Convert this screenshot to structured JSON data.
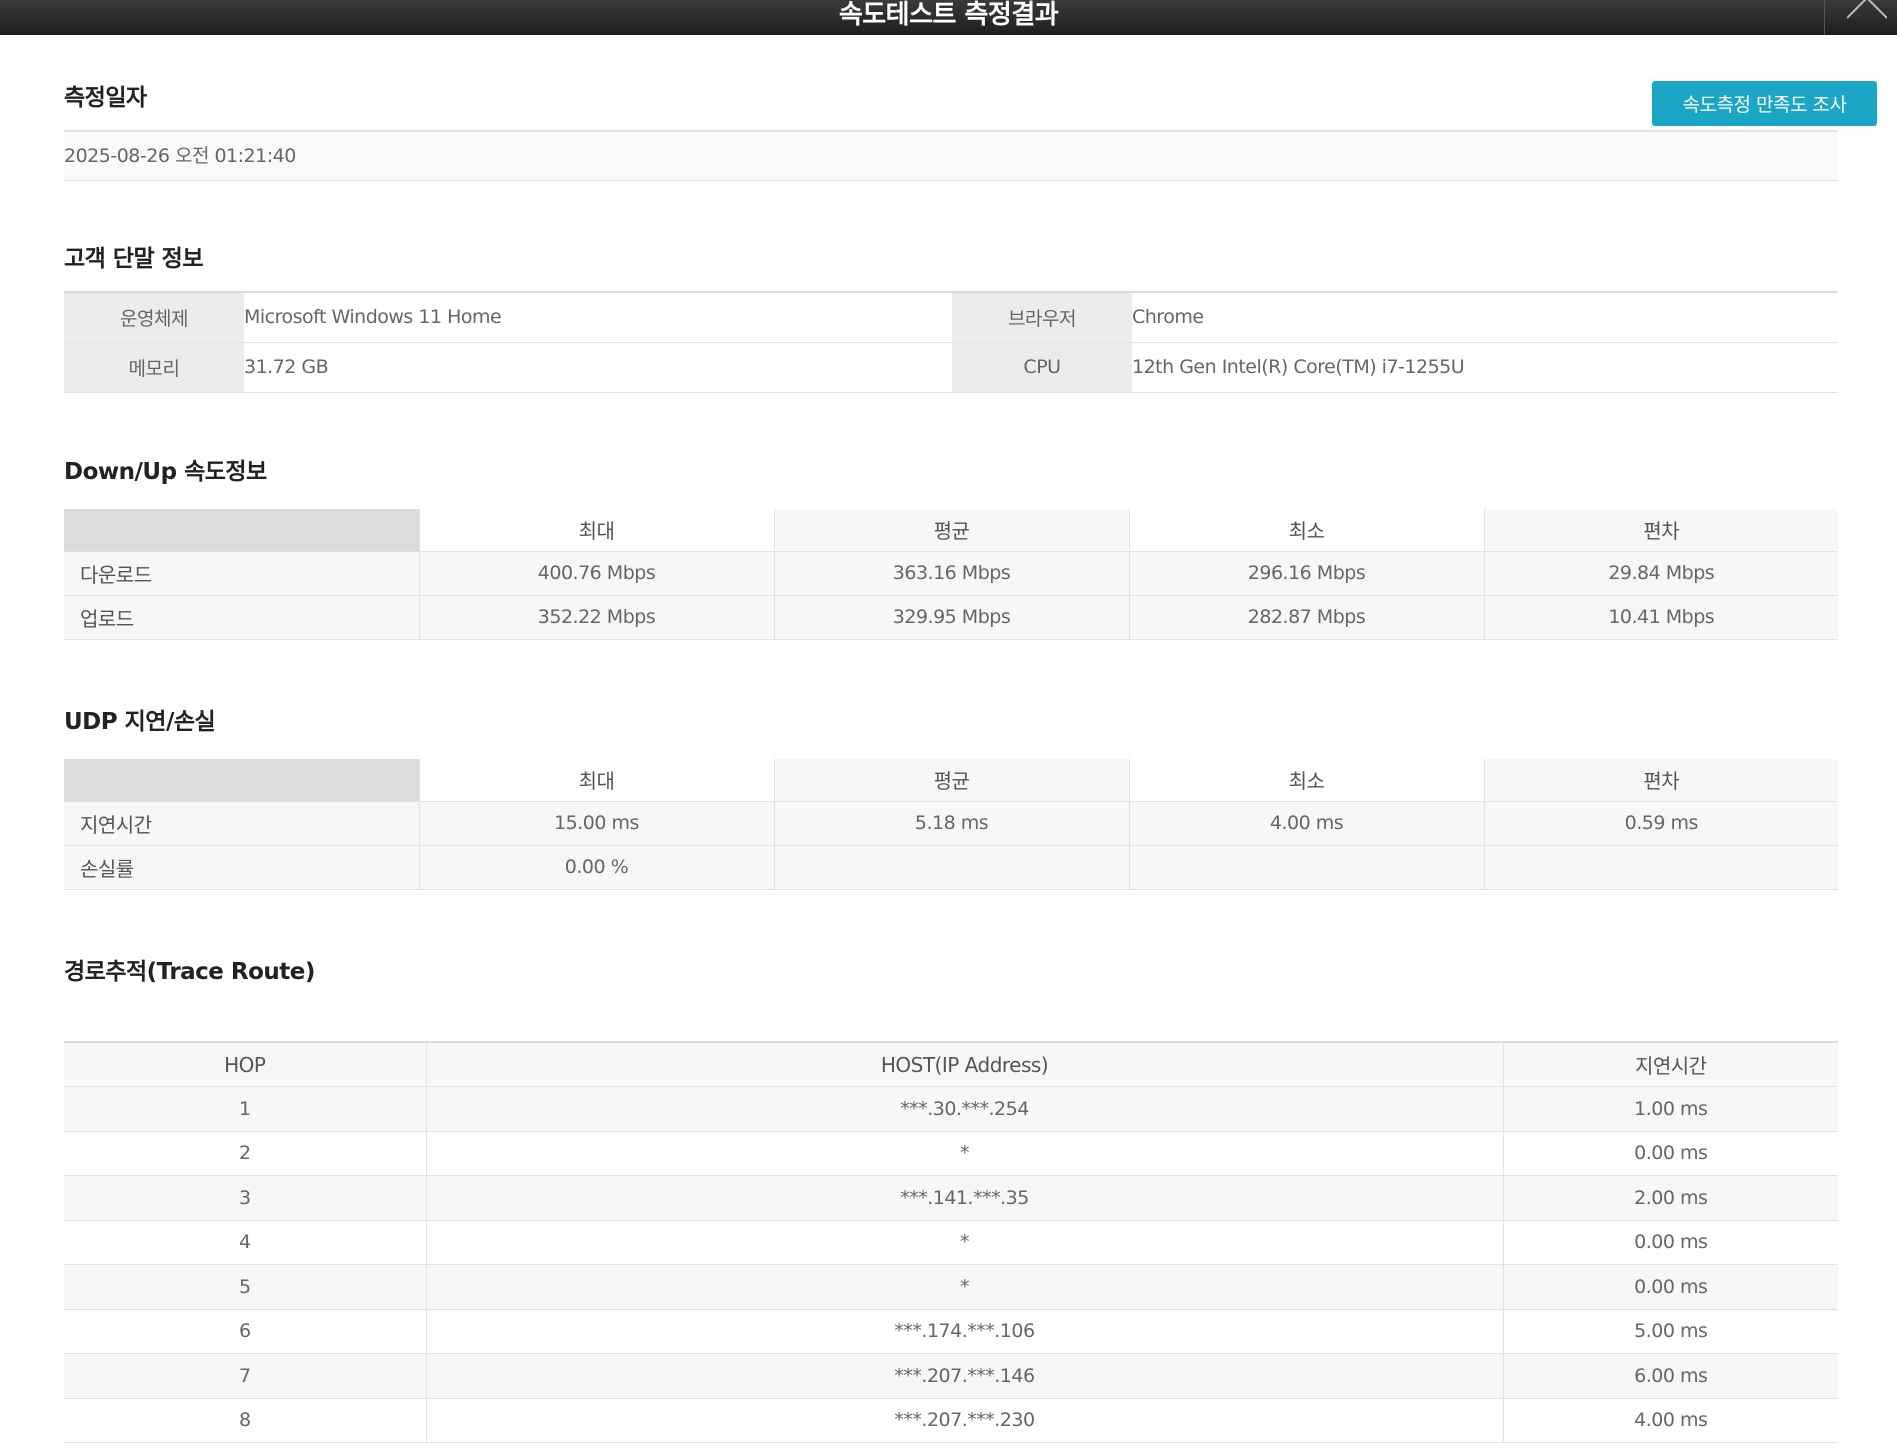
{
  "window": {
    "title": "속도테스트 측정결과",
    "close_icon": "close-icon"
  },
  "survey_button": "속도측정 만족도 조사",
  "measure_date": {
    "title": "측정일자",
    "value": "2025-08-26 오전 01:21:40"
  },
  "device": {
    "title": "고객 단말 정보",
    "rows": [
      {
        "label1": "운영체제",
        "value1": "Microsoft Windows 11 Home",
        "label2": "브라우저",
        "value2": "Chrome"
      },
      {
        "label1": "메모리",
        "value1": "31.72 GB",
        "label2": "CPU",
        "value2": "12th Gen Intel(R) Core(TM) i7-1255U"
      }
    ]
  },
  "speed": {
    "title": "Down/Up 속도정보",
    "headers": [
      "최대",
      "평균",
      "최소",
      "편차"
    ],
    "rows": [
      {
        "label": "다운로드",
        "values": [
          "400.76 Mbps",
          "363.16 Mbps",
          "296.16 Mbps",
          "29.84 Mbps"
        ]
      },
      {
        "label": "업로드",
        "values": [
          "352.22 Mbps",
          "329.95 Mbps",
          "282.87 Mbps",
          "10.41 Mbps"
        ]
      }
    ]
  },
  "udp": {
    "title": "UDP 지연/손실",
    "headers": [
      "최대",
      "평균",
      "최소",
      "편차"
    ],
    "rows": [
      {
        "label": "지연시간",
        "values": [
          "15.00 ms",
          "5.18 ms",
          "4.00 ms",
          "0.59 ms"
        ]
      },
      {
        "label": "손실률",
        "values": [
          "0.00 %",
          "",
          "",
          ""
        ]
      }
    ]
  },
  "trace": {
    "title": "경로추적(Trace Route)",
    "headers": [
      "HOP",
      "HOST(IP Address)",
      "지연시간"
    ],
    "rows": [
      {
        "hop": "1",
        "host": "***.30.***.254",
        "latency": "1.00 ms"
      },
      {
        "hop": "2",
        "host": "*",
        "latency": "0.00 ms"
      },
      {
        "hop": "3",
        "host": "***.141.***.35",
        "latency": "2.00 ms"
      },
      {
        "hop": "4",
        "host": "*",
        "latency": "0.00 ms"
      },
      {
        "hop": "5",
        "host": "*",
        "latency": "0.00 ms"
      },
      {
        "hop": "6",
        "host": "***.174.***.106",
        "latency": "5.00 ms"
      },
      {
        "hop": "7",
        "host": "***.207.***.146",
        "latency": "6.00 ms"
      },
      {
        "hop": "8",
        "host": "***.207.***.230",
        "latency": "4.00 ms"
      }
    ]
  }
}
